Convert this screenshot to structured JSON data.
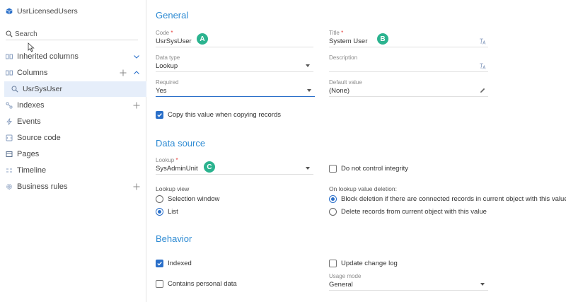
{
  "sidebar": {
    "object_name": "UsrLicensedUsers",
    "search_placeholder": "Search",
    "items": [
      {
        "label": "Inherited columns"
      },
      {
        "label": "Columns"
      },
      {
        "label": "Indexes"
      },
      {
        "label": "Events"
      },
      {
        "label": "Source code"
      },
      {
        "label": "Pages"
      },
      {
        "label": "Timeline"
      },
      {
        "label": "Business rules"
      }
    ],
    "selected_column": "UsrSysUser"
  },
  "general": {
    "title": "General",
    "code": {
      "label": "Code",
      "value": "UsrSysUser",
      "badge": "A"
    },
    "title_field": {
      "label": "Title",
      "value": "System User",
      "badge": "B"
    },
    "data_type": {
      "label": "Data type",
      "value": "Lookup"
    },
    "description": {
      "label": "Description",
      "value": ""
    },
    "required": {
      "label": "Required",
      "value": "Yes"
    },
    "default_value": {
      "label": "Default value",
      "value": "(None)"
    },
    "copy_value": {
      "label": "Copy this value when copying records",
      "checked": true
    },
    "required_mark": "*"
  },
  "data_source": {
    "title": "Data source",
    "lookup": {
      "label": "Lookup",
      "value": "SysAdminUnit",
      "badge": "C"
    },
    "do_not_control_integrity": {
      "label": "Do not control integrity",
      "checked": false
    },
    "lookup_view": {
      "label": "Lookup view",
      "options": [
        {
          "label": "Selection window",
          "selected": false
        },
        {
          "label": "List",
          "selected": true
        }
      ]
    },
    "on_deletion": {
      "label": "On lookup value deletion:",
      "options": [
        {
          "label": "Block deletion if there are connected records in current object with this value",
          "selected": true
        },
        {
          "label": "Delete records from current object with this value",
          "selected": false
        }
      ]
    }
  },
  "behavior": {
    "title": "Behavior",
    "indexed": {
      "label": "Indexed",
      "checked": true
    },
    "update_change_log": {
      "label": "Update change log",
      "checked": false
    },
    "contains_personal_data": {
      "label": "Contains personal data",
      "checked": false
    },
    "usage_mode": {
      "label": "Usage mode",
      "value": "General"
    }
  },
  "colors": {
    "accent": "#2e8bd3",
    "badge": "#2bb38f",
    "selection": "#e6eefa",
    "checkbox": "#2a6fc9",
    "required": "#e53935"
  }
}
